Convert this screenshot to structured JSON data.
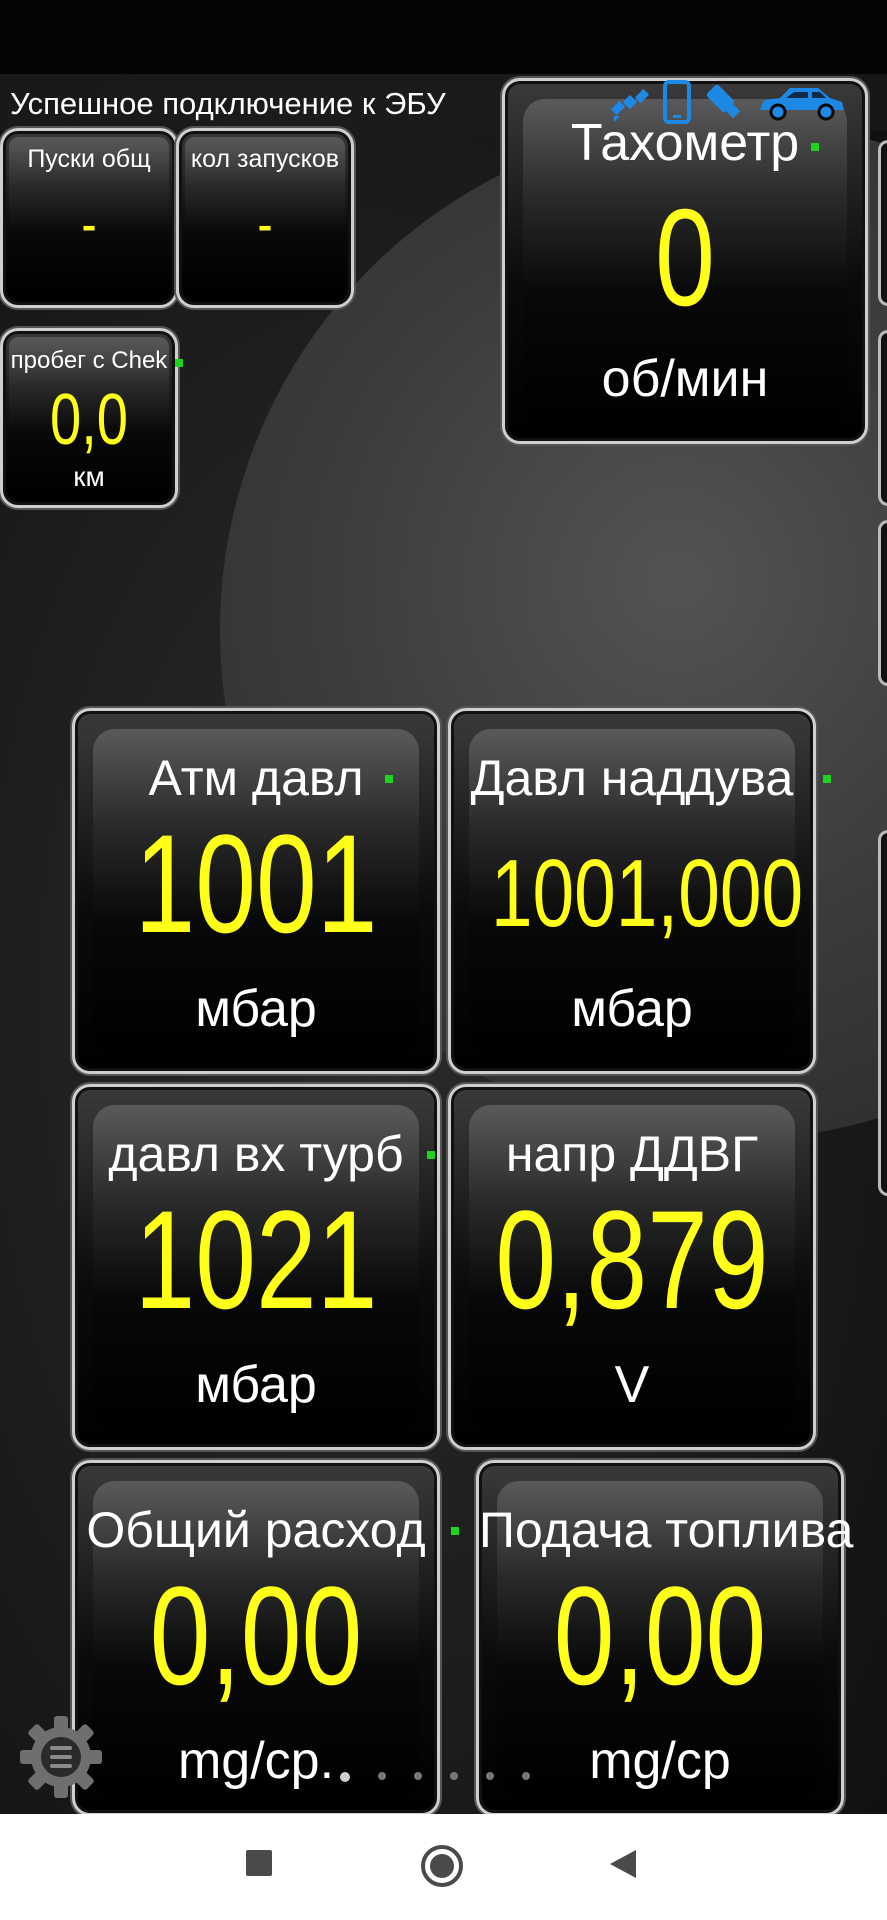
{
  "status": {
    "connection_text": "Успешное подключение к ЭБУ"
  },
  "status_icons": [
    "satellite-icon",
    "phone-icon",
    "usb-adapter-icon",
    "car-icon"
  ],
  "colors": {
    "value": "#ffff1a",
    "label": "#ffffff",
    "indicator": "#1ed41e",
    "background": "#151515"
  },
  "small_gauges": [
    {
      "label": "Пуски общ",
      "value": "-"
    },
    {
      "label": "кол запусков",
      "value": "-"
    },
    {
      "label": "пробег с Chek",
      "value": "0,0",
      "unit": "км"
    }
  ],
  "tachometer": {
    "label": "Тахометр",
    "value": "0",
    "unit": "об/мин"
  },
  "gauges": [
    {
      "label": "Атм давл",
      "value": "1001",
      "unit": "мбар"
    },
    {
      "label": "Давл наддува",
      "value": "1001,000",
      "unit": "мбар"
    },
    {
      "label": "давл вх турб",
      "value": "1021",
      "unit": "мбар"
    },
    {
      "label": "напр ДДВГ",
      "value": "0,879",
      "unit": "V"
    },
    {
      "label": "Общий расход",
      "value": "0,00",
      "unit": "mg/cp."
    },
    {
      "label": "Подача топлива",
      "value": "0,00",
      "unit": "mg/cp"
    }
  ],
  "pager": {
    "pages": 6,
    "current": 1
  },
  "navbar": [
    "recent-apps-button",
    "home-button",
    "back-button"
  ]
}
